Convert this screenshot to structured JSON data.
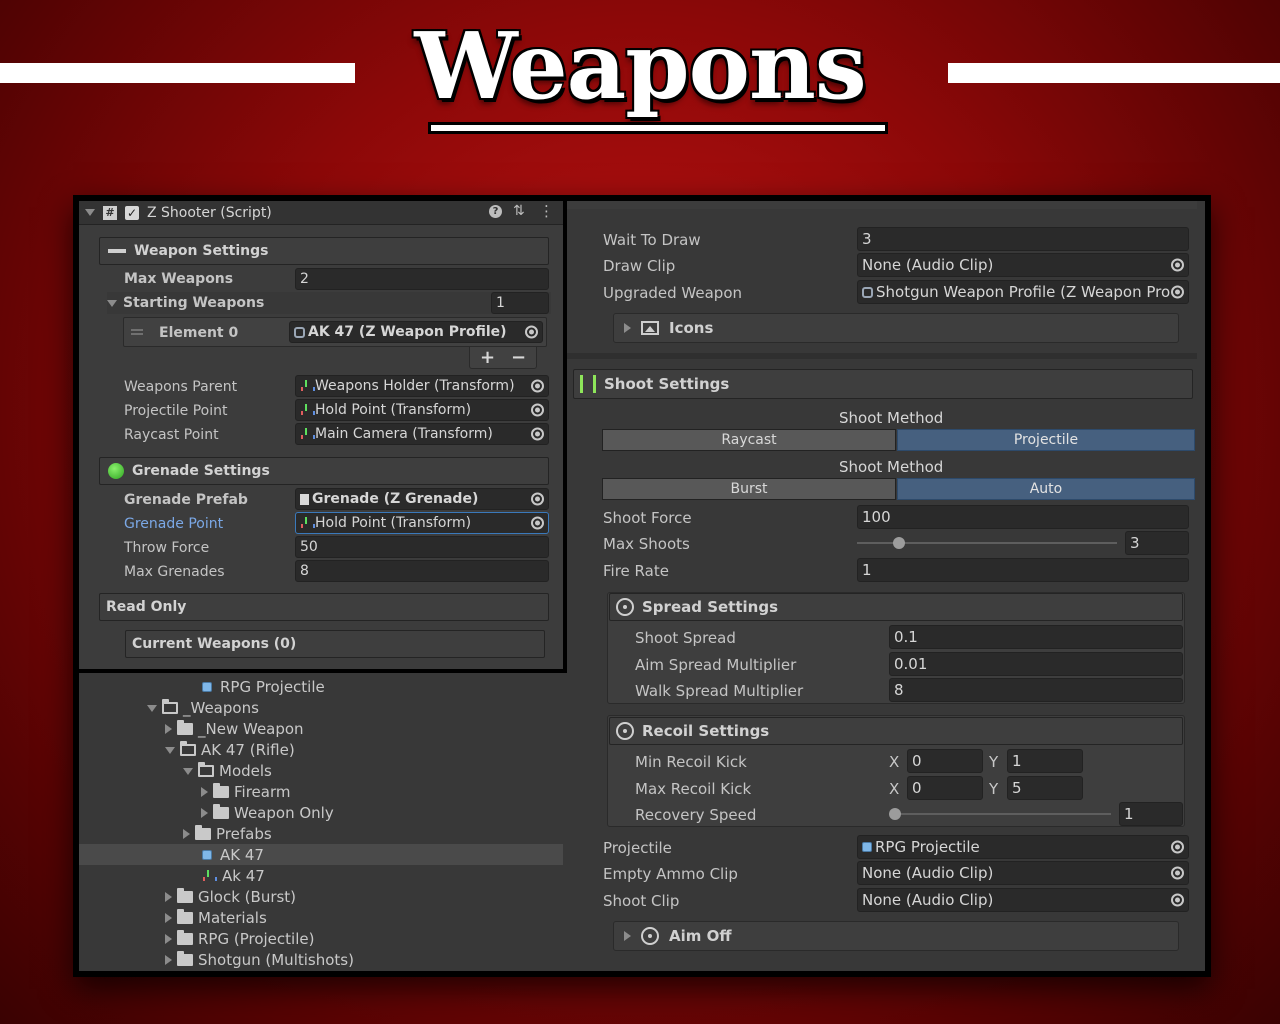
{
  "banner": {
    "title": "Weapons"
  },
  "inspector": {
    "component_title": "Z Shooter (Script)",
    "weapon_settings": {
      "heading": "Weapon Settings",
      "max_weapons_label": "Max Weapons",
      "max_weapons_value": "2",
      "starting_weapons_label": "Starting Weapons",
      "starting_weapons_count": "1",
      "element_label": "Element 0",
      "element_value": "AK 47 (Z Weapon Profile)",
      "add_label": "+",
      "remove_label": "−",
      "weapons_parent_label": "Weapons Parent",
      "weapons_parent_value": "Weapons Holder (Transform)",
      "projectile_point_label": "Projectile Point",
      "projectile_point_value": "Hold Point (Transform)",
      "raycast_point_label": "Raycast Point",
      "raycast_point_value": "Main Camera (Transform)"
    },
    "grenade_settings": {
      "heading": "Grenade Settings",
      "prefab_label": "Grenade Prefab",
      "prefab_value": "Grenade (Z Grenade)",
      "point_label": "Grenade Point",
      "point_value": "Hold Point (Transform)",
      "throw_force_label": "Throw Force",
      "throw_force_value": "50",
      "max_grenades_label": "Max Grenades",
      "max_grenades_value": "8"
    },
    "read_only": {
      "heading": "Read Only",
      "current_weapons": "Current Weapons (0)"
    }
  },
  "project_tree": [
    {
      "label": "RPG Projectile",
      "icon": "prefab-icon"
    },
    {
      "label": "_Weapons",
      "icon": "folder-open-icon"
    },
    {
      "label": "_New Weapon",
      "icon": "folder-icon"
    },
    {
      "label": "AK 47 (Rifle)",
      "icon": "folder-open-icon"
    },
    {
      "label": "Models",
      "icon": "folder-open-icon"
    },
    {
      "label": "Firearm",
      "icon": "folder-icon"
    },
    {
      "label": "Weapon Only",
      "icon": "folder-icon"
    },
    {
      "label": "Prefabs",
      "icon": "folder-icon"
    },
    {
      "label": "AK 47",
      "icon": "prefab-icon",
      "selected": true
    },
    {
      "label": "Ak 47",
      "icon": "weapon-profile-icon"
    },
    {
      "label": "Glock (Burst)",
      "icon": "folder-icon"
    },
    {
      "label": "Materials",
      "icon": "folder-icon"
    },
    {
      "label": "RPG (Projectile)",
      "icon": "folder-icon"
    },
    {
      "label": "Shotgun (Multishots)",
      "icon": "folder-icon"
    }
  ],
  "weapon_profile": {
    "wait_to_draw_label": "Wait To Draw",
    "wait_to_draw_value": "3",
    "draw_clip_label": "Draw Clip",
    "draw_clip_value": "None (Audio Clip)",
    "upgraded_weapon_label": "Upgraded Weapon",
    "upgraded_weapon_value": "Shotgun Weapon Profile (Z Weapon Pro",
    "icons_label": "Icons",
    "shoot_settings": {
      "heading": "Shoot Settings",
      "method_heading_1": "Shoot Method",
      "method_options_1": [
        "Raycast",
        "Projectile"
      ],
      "method_selected_1": "Projectile",
      "method_heading_2": "Shoot Method",
      "method_options_2": [
        "Burst",
        "Auto"
      ],
      "method_selected_2": "Auto",
      "shoot_force_label": "Shoot Force",
      "shoot_force_value": "100",
      "max_shoots_label": "Max Shoots",
      "max_shoots_value": "3",
      "max_shoots_fraction": 0.16,
      "fire_rate_label": "Fire Rate",
      "fire_rate_value": "1"
    },
    "spread_settings": {
      "heading": "Spread Settings",
      "shoot_spread_label": "Shoot Spread",
      "shoot_spread_value": "0.1",
      "aim_spread_label": "Aim Spread Multiplier",
      "aim_spread_value": "0.01",
      "walk_spread_label": "Walk Spread Multiplier",
      "walk_spread_value": "8"
    },
    "recoil_settings": {
      "heading": "Recoil Settings",
      "min_kick_label": "Min Recoil Kick",
      "min_kick_x": "0",
      "min_kick_y": "1",
      "max_kick_label": "Max Recoil Kick",
      "max_kick_x": "0",
      "max_kick_y": "5",
      "x_label": "X",
      "y_label": "Y",
      "recovery_label": "Recovery Speed",
      "recovery_value": "1",
      "recovery_fraction": 0.0
    },
    "projectile_label": "Projectile",
    "projectile_value": "RPG Projectile",
    "empty_ammo_label": "Empty Ammo Clip",
    "empty_ammo_value": "None (Audio Clip)",
    "shoot_clip_label": "Shoot Clip",
    "shoot_clip_value": "None (Audio Clip)",
    "aim_off_label": "Aim Off"
  },
  "colors": {
    "background": "#8c0808",
    "panel": "#383838",
    "field": "#2a2a2a",
    "selected_segment": "#46607f",
    "highlight_label": "#7ba8e6",
    "toggle_on": "#2ea521"
  }
}
